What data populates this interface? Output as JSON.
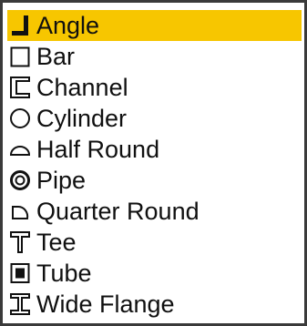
{
  "listbox": {
    "selected_index": 0,
    "selection_color": "#f7c600",
    "items": [
      {
        "label": "Angle",
        "icon": "angle-shape-icon"
      },
      {
        "label": "Bar",
        "icon": "bar-shape-icon"
      },
      {
        "label": "Channel",
        "icon": "channel-shape-icon"
      },
      {
        "label": "Cylinder",
        "icon": "cylinder-shape-icon"
      },
      {
        "label": "Half Round",
        "icon": "half-round-shape-icon"
      },
      {
        "label": "Pipe",
        "icon": "pipe-shape-icon"
      },
      {
        "label": "Quarter Round",
        "icon": "quarter-round-shape-icon"
      },
      {
        "label": "Tee",
        "icon": "tee-shape-icon"
      },
      {
        "label": "Tube",
        "icon": "tube-shape-icon"
      },
      {
        "label": "Wide Flange",
        "icon": "wide-flange-shape-icon"
      }
    ]
  }
}
